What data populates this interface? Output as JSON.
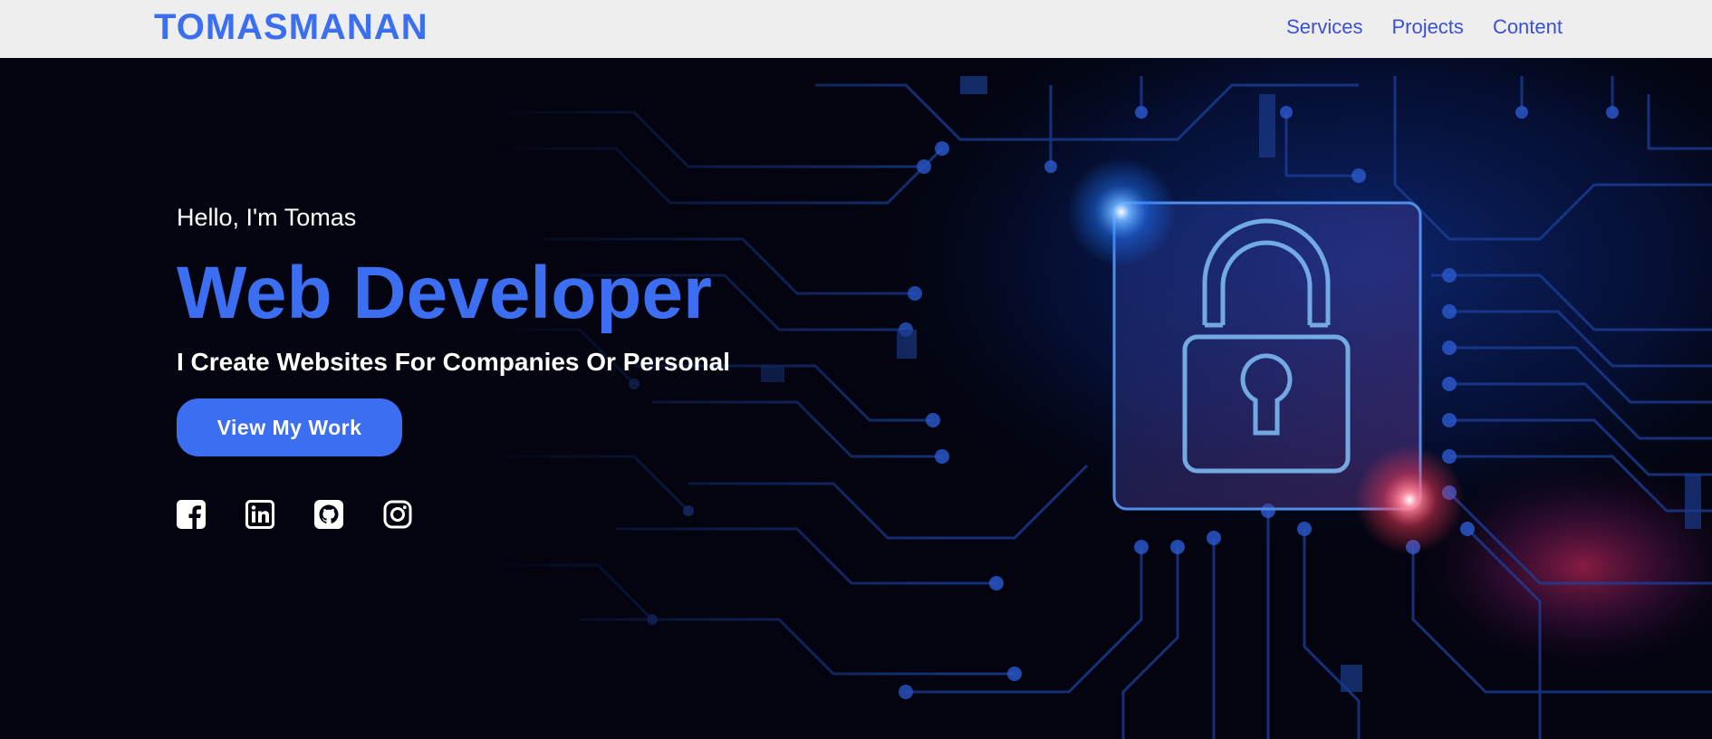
{
  "header": {
    "logo": "TOMASMANAN",
    "nav": [
      {
        "label": "Services"
      },
      {
        "label": "Projects"
      },
      {
        "label": "Content"
      }
    ]
  },
  "hero": {
    "greeting": "Hello, I'm Tomas",
    "headline": "Web Developer",
    "subline": "I Create Websites For Companies Or Personal",
    "cta_label": "View My Work",
    "background_image": "circuit-board-padlock",
    "socials": [
      {
        "icon": "facebook-icon"
      },
      {
        "icon": "linkedin-icon"
      },
      {
        "icon": "github-icon"
      },
      {
        "icon": "instagram-icon"
      }
    ]
  },
  "colors": {
    "accent": "#3b6ef0",
    "nav_link": "#3b4fd8",
    "nav_bg": "#eeeeee",
    "hero_bg": "#03040f",
    "text_light": "#ffffff",
    "glow_blue": "#1f78ff",
    "glow_red": "#ff3a5a"
  }
}
